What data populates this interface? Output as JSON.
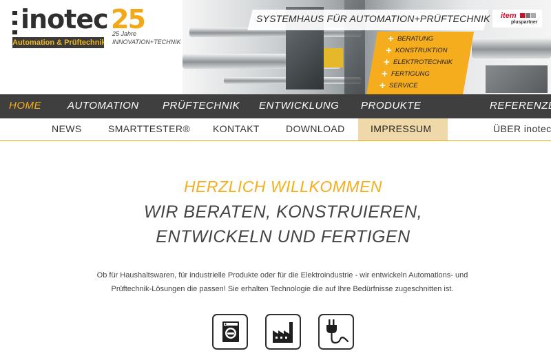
{
  "brand": {
    "name": "inotec",
    "subtitle": "Automation & Prüftechnik",
    "anniversary_number": "25",
    "anniversary_label": "25 Jahre",
    "tagline": "INNOVATION+TECHNIK"
  },
  "header": {
    "slogan": "SYSTEMHAUS FÜR AUTOMATION+PRÜFTECHNIK",
    "partner_logo": {
      "word": "item",
      "sub": "pluspartner"
    },
    "services": [
      "BERATUNG",
      "KONSTRUKTION",
      "ELEKTROTECHNIK",
      "FERTIGUNG",
      "SERVICE"
    ]
  },
  "nav_primary": [
    {
      "label": "HOME",
      "active": true
    },
    {
      "label": "AUTOMATION",
      "active": false
    },
    {
      "label": "PRÜFTECHNIK",
      "active": false
    },
    {
      "label": "ENTWICKLUNG",
      "active": false
    },
    {
      "label": "PRODUKTE",
      "active": false
    },
    {
      "label": "REFERENZEN",
      "active": false
    }
  ],
  "nav_secondary": [
    {
      "label": "NEWS"
    },
    {
      "label": "SMARTTESTER®"
    },
    {
      "label": "KONTAKT"
    },
    {
      "label": "DOWNLOAD"
    },
    {
      "label": "IMPRESSUM"
    },
    {
      "label": "ÜBER inotec"
    }
  ],
  "main": {
    "welcome": "HERZLICH WILLKOMMEN",
    "headline_line1": "WIR BERATEN, KONSTRUIEREN,",
    "headline_line2": "ENTWICKELN UND FERTIGEN",
    "intro_line1": "Ob für Haushaltswaren, für industrielle Produkte oder für die Elektroindustrie - wir entwickeln Automations- und",
    "intro_line2": "Prüftechnik-Lösungen die passen! Sie erhalten Technologie die auf Ihre Bedürfnisse zugeschnitten ist.",
    "icons": [
      "washing-machine-icon",
      "factory-icon",
      "power-plug-icon"
    ]
  },
  "colors": {
    "accent": "#f5ad1d",
    "nav_dark": "#3f3f3f",
    "text": "#444444",
    "partner_red": "#c8102e"
  }
}
